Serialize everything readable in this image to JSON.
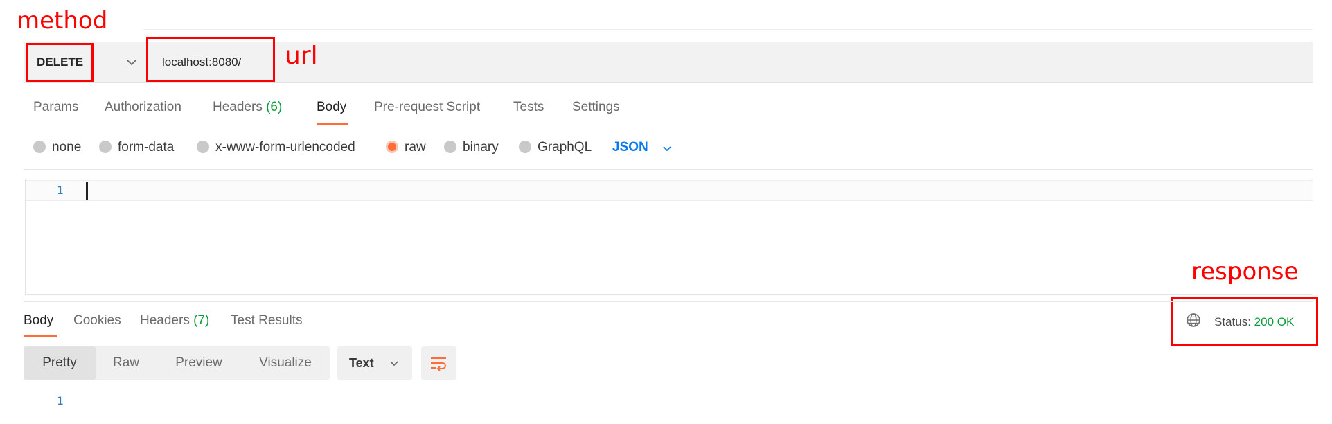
{
  "annotations": {
    "method": "method",
    "url": "url",
    "response": "response"
  },
  "request": {
    "method": "DELETE",
    "url": "localhost:8080/"
  },
  "request_tabs": {
    "params": "Params",
    "authorization": "Authorization",
    "headers": "Headers",
    "headers_count": "(6)",
    "body": "Body",
    "pre_request_script": "Pre-request Script",
    "tests": "Tests",
    "settings": "Settings"
  },
  "body_types": {
    "none": "none",
    "form_data": "form-data",
    "urlencoded": "x-www-form-urlencoded",
    "raw": "raw",
    "binary": "binary",
    "graphql": "GraphQL",
    "selected": "raw",
    "format": "JSON"
  },
  "editor": {
    "line_number": "1"
  },
  "response_tabs": {
    "body": "Body",
    "cookies": "Cookies",
    "headers": "Headers",
    "headers_count": "(7)",
    "test_results": "Test Results"
  },
  "response_status": {
    "label": "Status:",
    "value": "200 OK"
  },
  "response_view": {
    "pretty": "Pretty",
    "raw": "Raw",
    "preview": "Preview",
    "visualize": "Visualize",
    "format": "Text",
    "line_number": "1"
  },
  "colors": {
    "accent": "#ff6c37",
    "link_blue": "#097bed",
    "success_green": "#0c9b3b",
    "annotation_red": "#ff0000"
  }
}
